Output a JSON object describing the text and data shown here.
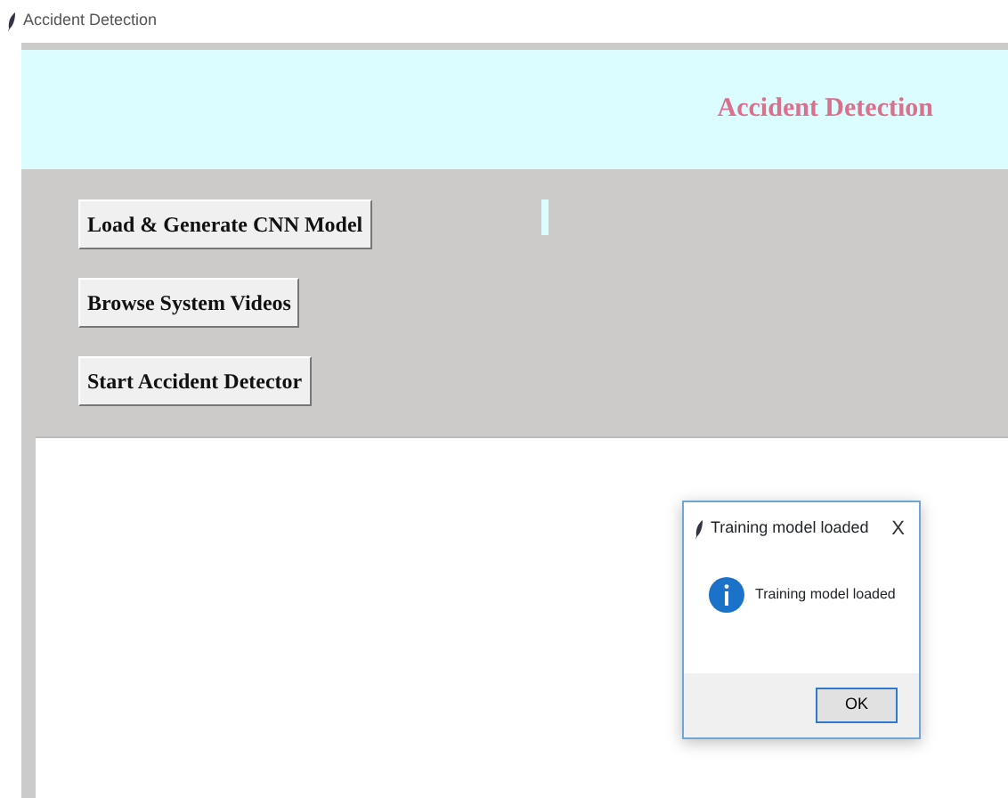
{
  "window": {
    "title": "Accident Detection"
  },
  "header": {
    "title": "Accident Detection"
  },
  "buttons": [
    "Load & Generate CNN Model",
    "Browse System Videos",
    "Start Accident Detector"
  ],
  "dialog": {
    "title": "Training model loaded",
    "close": "X",
    "message": "Training model loaded",
    "button": "OK"
  }
}
